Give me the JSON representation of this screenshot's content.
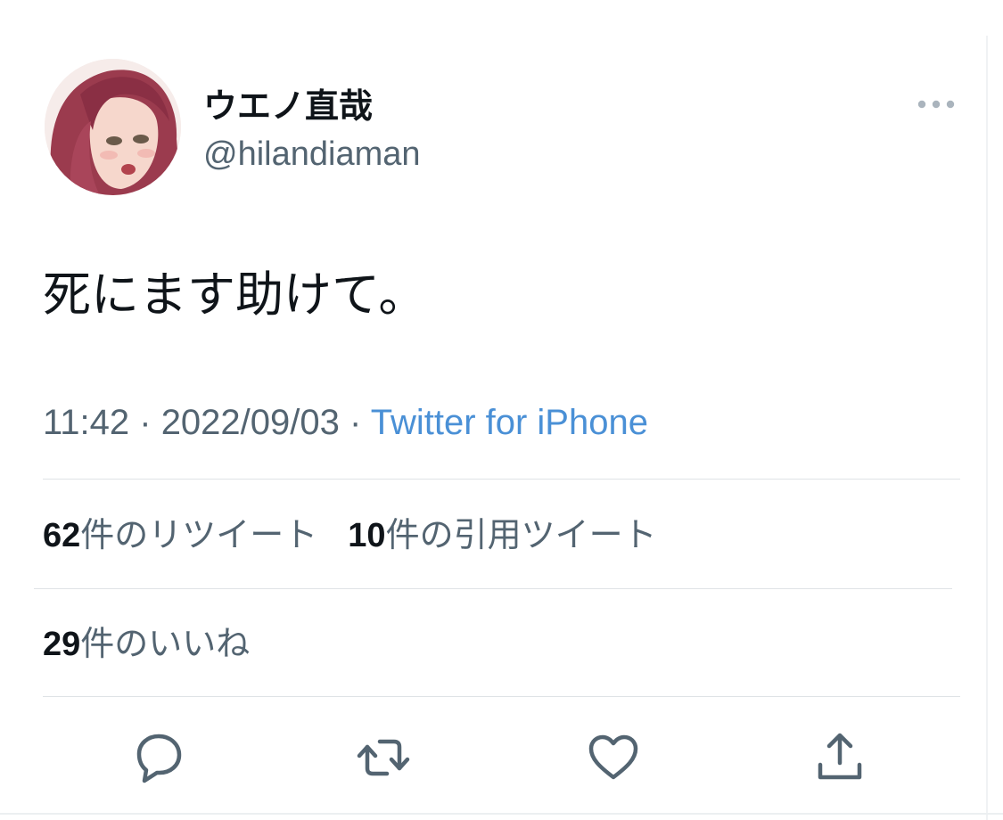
{
  "author": {
    "display_name": "ウエノ直哉",
    "handle": "@hilandiaman"
  },
  "tweet": {
    "text": "死にます助けて。",
    "time": "11:42",
    "separator": " · ",
    "date": "2022/09/03",
    "source": "Twitter for iPhone"
  },
  "stats": {
    "retweets_count": "62",
    "retweets_label": "件のリツイート",
    "quotes_count": "10",
    "quotes_label": "件の引用ツイート",
    "likes_count": "29",
    "likes_label": "件のいいね"
  },
  "actions": {
    "icons": [
      "reply-icon",
      "retweet-icon",
      "like-icon",
      "share-icon",
      "more-icon"
    ]
  },
  "colors": {
    "text_primary": "#0f1419",
    "text_secondary": "#536471",
    "link": "#4a90d6",
    "icon": "#536471",
    "divider": "#dfe3e6"
  }
}
